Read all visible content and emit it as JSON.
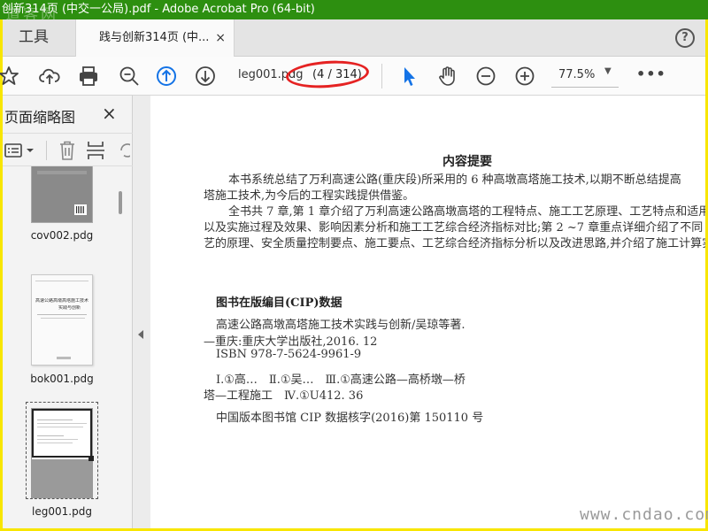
{
  "window": {
    "title": "创新314页 (中交一公局).pdf - Adobe Acrobat Pro (64-bit)",
    "watermark": "道客网"
  },
  "tabs": {
    "tools_label": "工具",
    "document_label": "践与创新314页 (中...",
    "close_glyph": "×",
    "help_glyph": "?"
  },
  "toolbar": {
    "icons": [
      "star-icon",
      "upload-cloud-icon",
      "print-icon",
      "zoom-out-search-icon",
      "page-up-icon",
      "page-down-icon",
      "select-arrow-icon",
      "hand-icon",
      "zoom-minus-icon",
      "zoom-plus-icon",
      "more-icon"
    ],
    "page_name": "leg001.pdg",
    "page_count": "(4 / 314)",
    "zoom": "77.5%",
    "more_glyph": "•••",
    "accent_color": "#1473e6",
    "annotation_color": "#e52222"
  },
  "sidebar": {
    "title": "页面缩略图",
    "close_glyph": "×",
    "thumbnails": [
      {
        "label": "cov002.pdg"
      },
      {
        "label": "bok001.pdg",
        "preview_title": "高速公路高墩高塔施工技术",
        "preview_subtitle": "实践与创新"
      },
      {
        "label": "leg001.pdg"
      }
    ]
  },
  "document": {
    "heading": "内容提要",
    "paragraphs": [
      "本书系统总结了万利高速公路(重庆段)所采用的 6 种高墩高塔施工技术,以期不断总结提高",
      "塔施工技术,为今后的工程实践提供借鉴。",
      "全书共 7 章,第 1 章介绍了万利高速公路高墩高塔的工程特点、施工工艺原理、工艺特点和适用",
      "以及实施过程及效果、影响因素分析和施工工艺综合经济指标对比;第 2 ~7 章重点详细介绍了不同",
      "艺的原理、安全质量控制要点、施工要点、工艺综合经济指标分析以及改进思路,并介绍了施工计算实"
    ],
    "cip_heading": "图书在版编目(CIP)数据",
    "cip_lines": [
      "高速公路高墩高塔施工技术实践与创新/吴琼等著.",
      "—重庆:重庆大学出版社,2016. 12",
      "ISBN 978-7-5624-9961-9",
      "Ⅰ.①高…　Ⅱ.①吴…　Ⅲ.①高速公路—高桥墩—桥",
      "塔—工程施工　Ⅳ.①U412. 36",
      "中国版本图书馆 CIP 数据核字(2016)第 150110 号"
    ]
  },
  "watermark_bottom": "www.cndao.com"
}
